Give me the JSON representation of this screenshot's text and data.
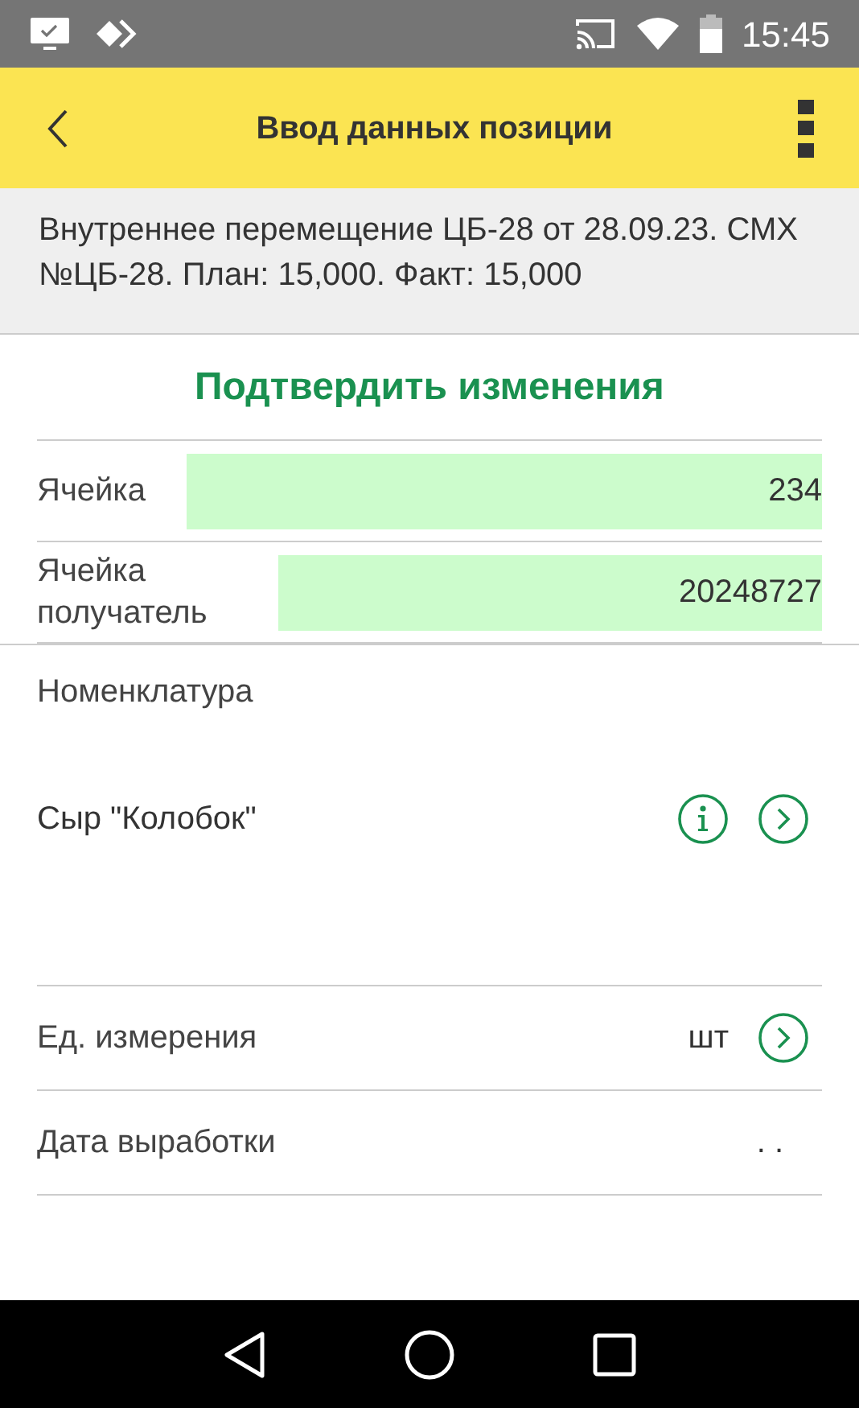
{
  "status_bar": {
    "time": "15:45"
  },
  "toolbar": {
    "title": "Ввод данных позиции"
  },
  "info": "Внутреннее перемещение ЦБ-28 от 28.09.23. СМХ №ЦБ-28. План: 15,000. Факт: 15,000",
  "confirm_button": "Подтвердить изменения",
  "cell_fields": [
    {
      "label": "Ячейка",
      "value": "234"
    },
    {
      "label": "Ячейка получатель",
      "value": "20248727"
    }
  ],
  "nomenclature": {
    "label": "Номенклатура",
    "value": "Сыр \"Колобок\""
  },
  "rows": [
    {
      "label": "Ед. измерения",
      "value": "шт",
      "kind": "select"
    },
    {
      "label": "Дата выработки",
      "value": ". .",
      "kind": "date"
    }
  ]
}
